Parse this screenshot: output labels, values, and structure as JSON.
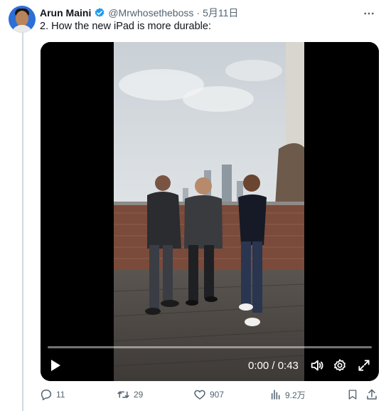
{
  "author": {
    "name": "Arun Maini",
    "handle": "@Mrwhosetheboss",
    "separator": "·",
    "date": "5月11日"
  },
  "tweet": {
    "text": "2. How the new iPad is more durable:"
  },
  "video": {
    "time": "0:00 / 0:43",
    "progress_fraction": 0
  },
  "actions": {
    "replies": "11",
    "retweets": "29",
    "likes": "907",
    "views": "9.2万"
  },
  "colors": {
    "verified": "#1d9bf0",
    "muted": "#536471",
    "thread_line": "#cfd9de"
  },
  "icons": [
    "verified-badge-icon",
    "more-icon",
    "play-icon",
    "volume-icon",
    "settings-icon",
    "fullscreen-icon",
    "reply-icon",
    "retweet-icon",
    "like-icon",
    "views-icon",
    "bookmark-icon",
    "share-icon"
  ]
}
